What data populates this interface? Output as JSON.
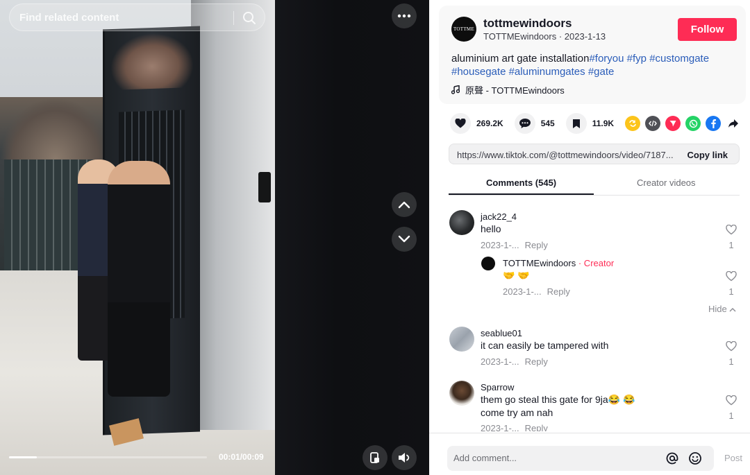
{
  "search": {
    "placeholder": "Find related content"
  },
  "player": {
    "time": "00:01/00:09",
    "progress": 0.14
  },
  "author": {
    "avatar_text": "TOTTME",
    "username": "tottmewindoors",
    "subtitle": "TOTTMEwindoors · 2023-1-13",
    "follow_label": "Follow"
  },
  "description": {
    "text": "aluminium art gate installation",
    "tags": [
      "#foryou",
      "#fyp",
      "#customgate",
      "#housegate",
      "#aluminumgates",
      "#gate"
    ]
  },
  "music": {
    "label": "原聲 - TOTTMEwindoors"
  },
  "stats": {
    "likes": "269.2K",
    "comments": "545",
    "saves": "11.9K"
  },
  "share_icons": [
    "repost-icon",
    "embed-icon",
    "send-icon",
    "whatsapp-icon",
    "facebook-icon",
    "share-arrow-icon"
  ],
  "link": {
    "url": "https://www.tiktok.com/@tottmewindoors/video/7187...",
    "copy_label": "Copy link"
  },
  "tabs": {
    "comments": "Comments (545)",
    "creator": "Creator videos"
  },
  "comments": [
    {
      "user": "jack22_4",
      "text": "hello",
      "date": "2023-1-...",
      "reply": "Reply",
      "likes": "1"
    },
    {
      "user": "TOTTMEwindoors",
      "creator_label": "· Creator",
      "text": "🤝 🤝",
      "date": "2023-1-...",
      "reply": "Reply",
      "likes": "1"
    },
    {
      "user": "seablue01",
      "text": "it can easily be tampered with",
      "date": "2023-1-...",
      "reply": "Reply",
      "likes": "1"
    },
    {
      "user": "Sparrow",
      "text_line1": "them go steal this gate for 9ja😂 😂",
      "text_line2": "come try am nah",
      "date": "2023-1-...",
      "reply": "Reply",
      "likes": "1"
    }
  ],
  "hide_label": "Hide",
  "composer": {
    "placeholder": "Add comment...",
    "post_label": "Post"
  },
  "colors": {
    "accent": "#fe2c55",
    "tag_blue": "#2b5db9"
  }
}
